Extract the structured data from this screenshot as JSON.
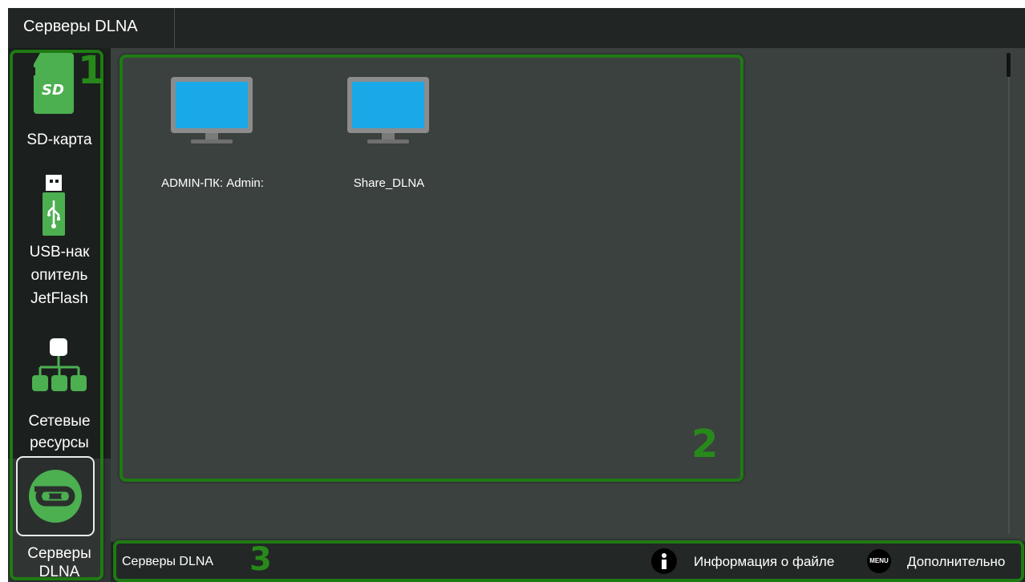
{
  "window": {
    "title": "Серверы DLNA"
  },
  "sidebar": {
    "items": [
      {
        "label": "SD-карта",
        "icon": "sd-card-icon"
      },
      {
        "label": "USB-нак опитель JetFlash",
        "label_lines": [
          "USB-нак",
          "опитель",
          "JetFlash"
        ],
        "icon": "usb-drive-icon"
      },
      {
        "label": "Сетевые ресурсы",
        "label_lines": [
          "Сетевые",
          "ресурсы"
        ],
        "icon": "network-icon"
      },
      {
        "label": "Серверы DLNA",
        "label_lines": [
          "Серверы",
          "DLNA"
        ],
        "icon": "dlna-icon",
        "selected": true
      }
    ]
  },
  "main": {
    "servers": [
      {
        "name": "ADMIN-ПК: Admin:",
        "icon": "monitor-icon"
      },
      {
        "name": "Share_DLNA",
        "icon": "monitor-icon"
      }
    ]
  },
  "bottombar": {
    "title": "Серверы DLNA",
    "info_label": "Информация о файле",
    "menu_key": "MENU",
    "menu_label": "Дополнительно"
  },
  "annotations": {
    "one": "1",
    "two": "2",
    "three": "3"
  },
  "colors": {
    "accent_green": "#4caf50",
    "highlight_green": "#1f7a14",
    "background": "#3b413f",
    "screen_blue": "#1aa9e8"
  }
}
